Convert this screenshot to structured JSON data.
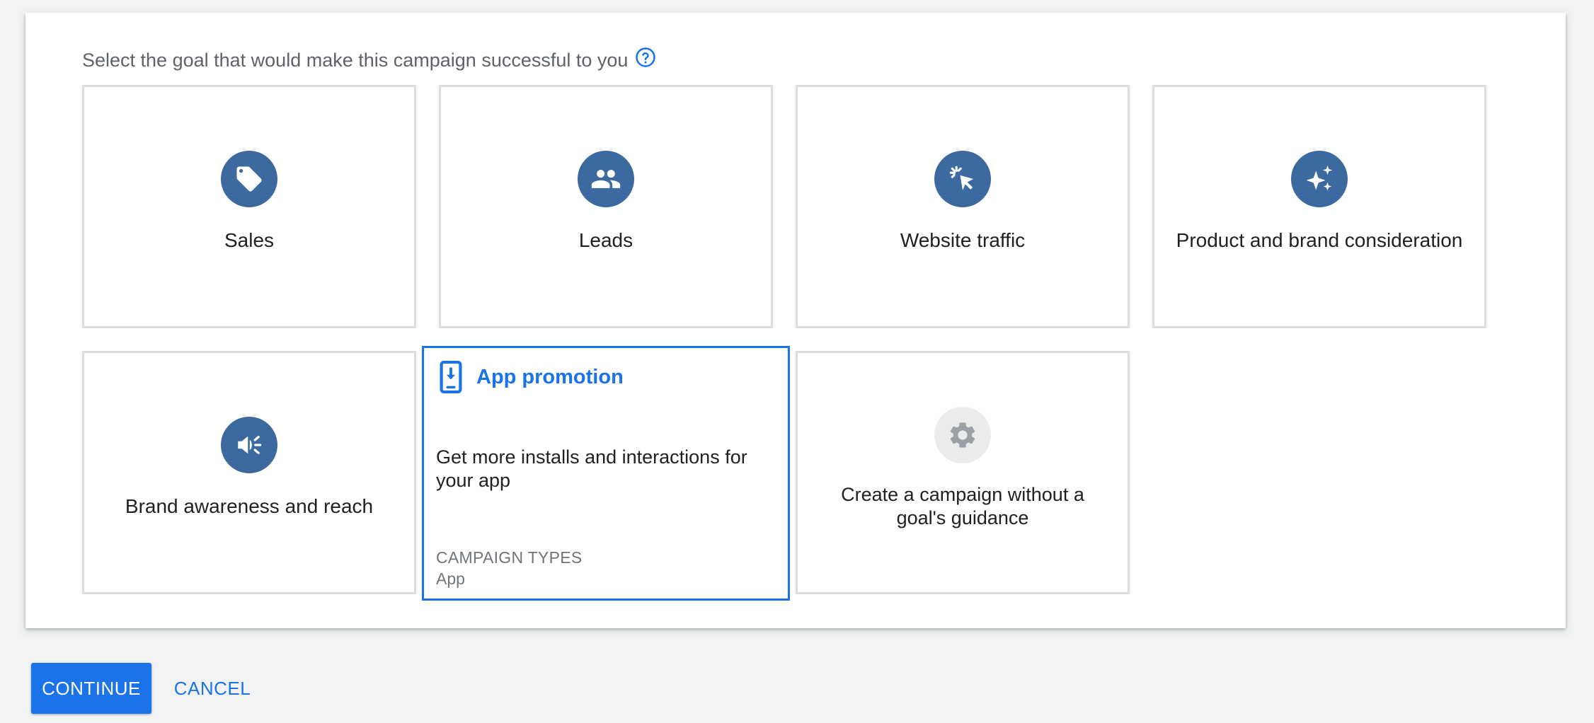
{
  "prompt": {
    "text": "Select the goal that would make this campaign successful to you",
    "help_icon": "help-circle-icon"
  },
  "goals": [
    {
      "label": "Sales",
      "icon": "tag-icon"
    },
    {
      "label": "Leads",
      "icon": "people-icon"
    },
    {
      "label": "Website traffic",
      "icon": "cursor-click-icon"
    },
    {
      "label": "Product and brand consideration",
      "icon": "sparkle-icon"
    },
    {
      "label": "Brand awareness and reach",
      "icon": "megaphone-icon"
    },
    {
      "label": "App promotion",
      "icon": "phone-download-icon",
      "selected": true,
      "description": "Get more installs and interactions for your app",
      "campaign_types_label": "CAMPAIGN TYPES",
      "campaign_types_value": "App"
    },
    {
      "label": "Create a campaign without a goal's guidance",
      "icon": "gear-icon"
    }
  ],
  "actions": {
    "continue_label": "CONTINUE",
    "cancel_label": "CANCEL"
  },
  "colors": {
    "accent": "#1a73e8",
    "icon_circle": "#3c6aa0",
    "border": "#dadce0"
  }
}
